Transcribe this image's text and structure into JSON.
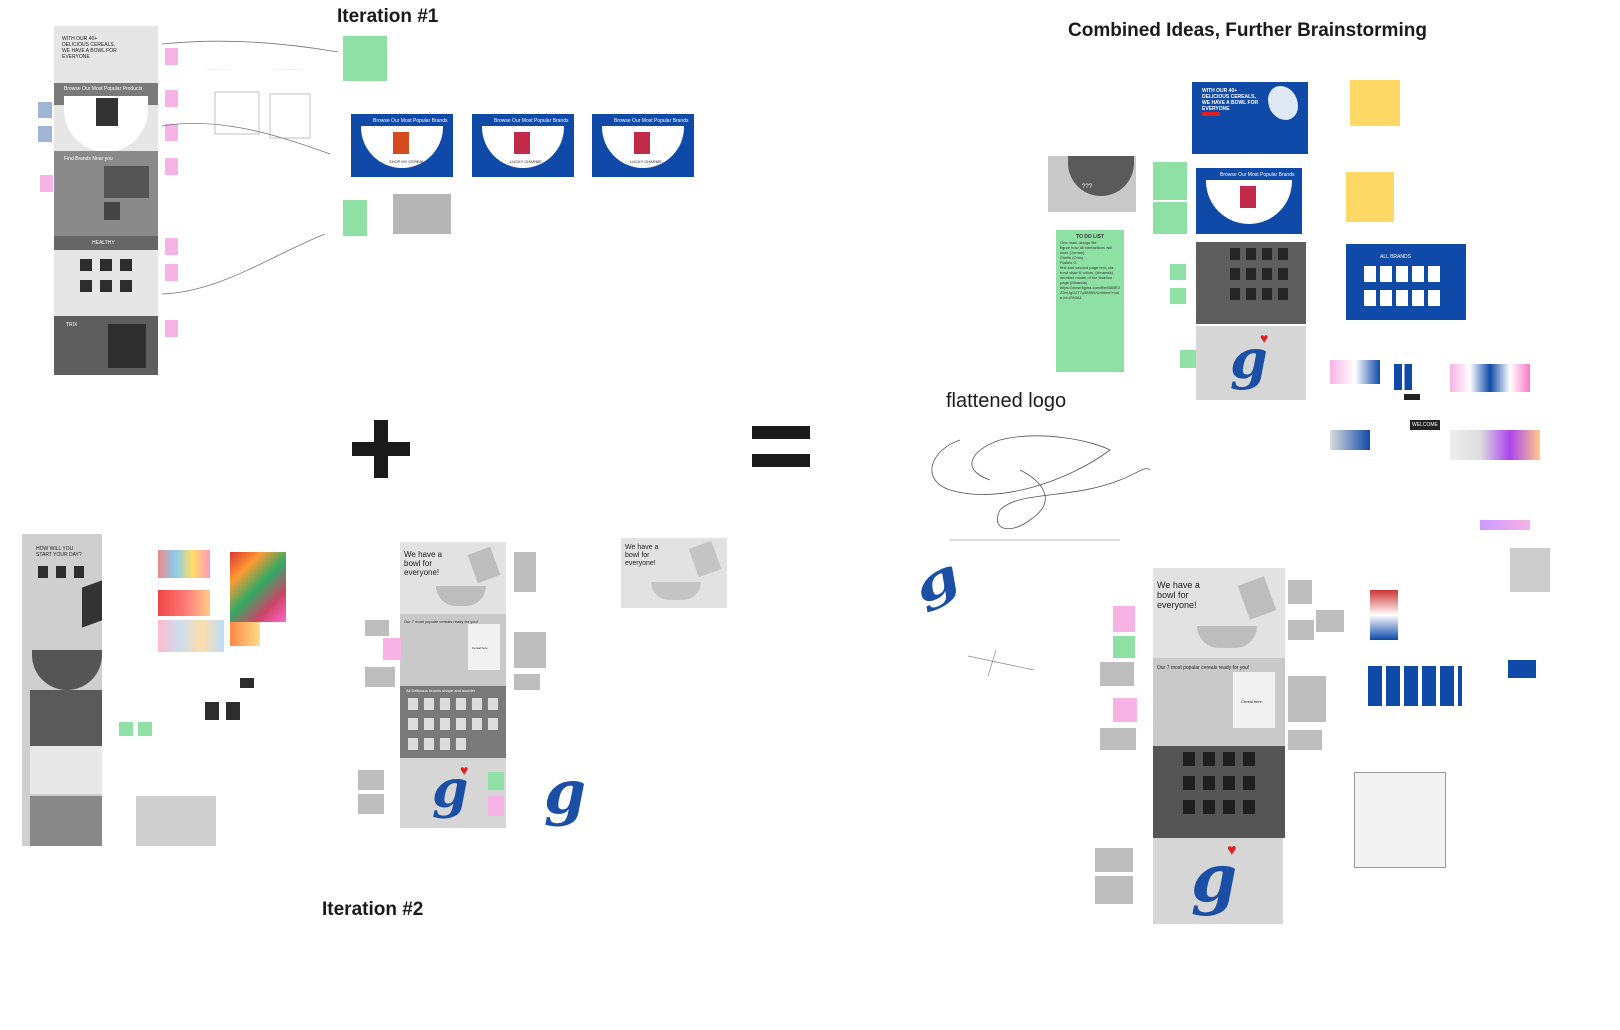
{
  "canvas": {
    "titles": {
      "iteration1": "Iteration  #1",
      "iteration2": "Iteration #2",
      "combined": "Combined Ideas, Further Brainstorming",
      "flattened": "flattened logo"
    },
    "operators": {
      "plus": "+",
      "equals": "="
    }
  },
  "iteration1_frame": {
    "hero_text": "WITH OUR 40+ DELICIOUS CEREALS, WE HAVE A BOWL FOR EVERYONE",
    "section_products": "Browse Our Most Popular Products",
    "section_find": "Find Brands Near you",
    "section_healthy": "HEALTHY",
    "section_trix": "TRIX"
  },
  "iteration1_cards": {
    "card_title": "Browse Our Most Popular Brands",
    "card_labels": [
      "SHOP MY CEREAL",
      "LUCKY CHARMS",
      "LUCKY CHARMS"
    ]
  },
  "iteration2": {
    "how_start": "HOW WILL YOU START YOUR DAY?",
    "bowl_text": "We have a bowl for everyone!",
    "popular": "Our 7 most popular cereals ready for you!",
    "all_cereals": "All Delicious brands shape and wonder",
    "cereal_here": "Cereal here"
  },
  "combined": {
    "hero_text": "WITH OUR 40+ DELICIOUS CEREALS, WE HAVE A BOWL FOR EVERYONE",
    "browse": "Browse Our Most Popular Brands",
    "all_brands": "ALL BRANDS",
    "todo_title": "TO DO LIST",
    "todo_items": [
      "One main design file",
      "figure how all interactions will work (Jordan)",
      "Shelfs (Chlo)",
      "Flatten G",
      "first and second page text, cta, bowl style & colors, (Amanda)",
      "iteration model of the timeline page (Miranda)",
      "https://www.figma.com/file/B8BE0Z5mJgGJT7y5889V/Untitled?node-id=0%3A1"
    ],
    "unknown": "???",
    "welcome": "WELCOME",
    "bowl_text": "We have a bowl for everyone!",
    "popular": "Our 7 most popular cereals ready for you!",
    "cereal_here": "Cereal here"
  },
  "colors": {
    "brand_blue": "#0f4aa8",
    "sticky_pink": "#f7b3e6",
    "sticky_green": "#8fe0a5",
    "sticky_yellow": "#ffd966",
    "heart_red": "#e02020"
  },
  "icons": {
    "plus": "plus-icon",
    "equals": "equals-icon",
    "logo": "g-logo-icon",
    "heart": "heart-icon"
  }
}
